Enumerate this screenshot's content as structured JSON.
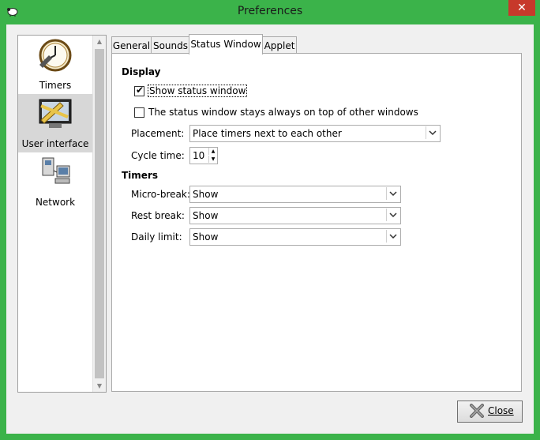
{
  "window": {
    "title": "Preferences",
    "close_glyph": "✕"
  },
  "sidebar": {
    "items": [
      {
        "label": "Timers",
        "icon": "clock-icon"
      },
      {
        "label": "User interface",
        "icon": "monitor-tools-icon"
      },
      {
        "label": "Network",
        "icon": "network-icon"
      }
    ]
  },
  "tabs": [
    {
      "label": "General"
    },
    {
      "label": "Sounds"
    },
    {
      "label": "Status Window"
    },
    {
      "label": "Applet"
    }
  ],
  "display": {
    "heading": "Display",
    "show_status_window": {
      "label": "Show status window",
      "checked": true
    },
    "always_on_top": {
      "label": "The status window stays always on top of other windows",
      "checked": false
    },
    "placement": {
      "label": "Placement:",
      "value": "Place timers next to each other"
    },
    "cycle_time": {
      "label": "Cycle time:",
      "value": "10"
    }
  },
  "timers": {
    "heading": "Timers",
    "micro_break": {
      "label": "Micro-break:",
      "value": "Show"
    },
    "rest_break": {
      "label": "Rest break:",
      "value": "Show"
    },
    "daily_limit": {
      "label": "Daily limit:",
      "value": "Show"
    }
  },
  "footer": {
    "close_label": "Close"
  }
}
